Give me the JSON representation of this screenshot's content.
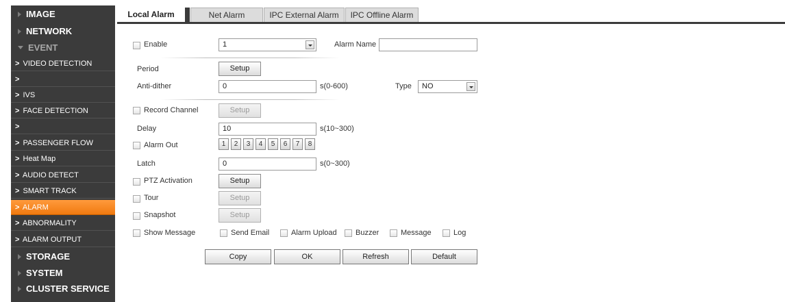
{
  "sidebar": {
    "items": [
      {
        "label": "IMAGE",
        "kind": "main"
      },
      {
        "label": "NETWORK",
        "kind": "main"
      },
      {
        "label": "EVENT",
        "kind": "main",
        "expanded": true
      },
      {
        "label": "VIDEO DETECTION",
        "kind": "sub"
      },
      {
        "label": "",
        "kind": "sub"
      },
      {
        "label": "IVS",
        "kind": "sub"
      },
      {
        "label": "FACE DETECTION",
        "kind": "sub"
      },
      {
        "label": "",
        "kind": "sub"
      },
      {
        "label": "PASSENGER FLOW",
        "kind": "sub"
      },
      {
        "label": "Heat Map",
        "kind": "sub"
      },
      {
        "label": "AUDIO DETECT",
        "kind": "sub"
      },
      {
        "label": "SMART TRACK",
        "kind": "sub"
      },
      {
        "label": "ALARM",
        "kind": "sub",
        "active": true
      },
      {
        "label": "ABNORMALITY",
        "kind": "sub"
      },
      {
        "label": "ALARM OUTPUT",
        "kind": "sub"
      },
      {
        "label": "STORAGE",
        "kind": "main"
      },
      {
        "label": "SYSTEM",
        "kind": "main"
      },
      {
        "label": "CLUSTER SERVICE",
        "kind": "main"
      }
    ],
    "sub_prefix": ">"
  },
  "tabs": [
    {
      "label": "Local Alarm",
      "active": true
    },
    {
      "label": "Net Alarm",
      "active": false
    },
    {
      "label": "IPC External Alarm",
      "active": false
    },
    {
      "label": "IPC Offline Alarm",
      "active": false
    }
  ],
  "form": {
    "enable_label": "Enable",
    "enable_value": "1",
    "alarm_name_label": "Alarm Name",
    "alarm_name_value": "",
    "period_label": "Period",
    "setup_label": "Setup",
    "anti_dither_label": "Anti-dither",
    "anti_dither_value": "0",
    "anti_dither_unit": "s(0-600)",
    "type_label": "Type",
    "type_value": "NO",
    "record_channel_label": "Record Channel",
    "delay_label": "Delay",
    "delay_value": "10",
    "delay_unit": "s(10~300)",
    "alarm_out_label": "Alarm Out",
    "alarm_out_channels": [
      "1",
      "2",
      "3",
      "4",
      "5",
      "6",
      "7",
      "8"
    ],
    "latch_label": "Latch",
    "latch_value": "0",
    "latch_unit": "s(0~300)",
    "ptz_label": "PTZ Activation",
    "tour_label": "Tour",
    "snapshot_label": "Snapshot",
    "show_message_label": "Show Message",
    "send_email_label": "Send Email",
    "alarm_upload_label": "Alarm Upload",
    "buzzer_label": "Buzzer",
    "message_label": "Message",
    "log_label": "Log"
  },
  "buttons": {
    "copy": "Copy",
    "ok": "OK",
    "refresh": "Refresh",
    "default": "Default"
  }
}
